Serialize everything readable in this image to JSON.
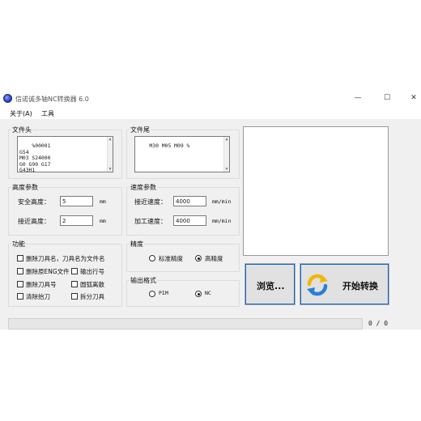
{
  "window": {
    "title": "信诺诚多轴NC转换器 6.0",
    "minimize": "—",
    "maximize": "☐",
    "close": "✕"
  },
  "menu": [
    "关于(A)",
    "工具"
  ],
  "file_header": {
    "title": "文件头",
    "lines": "%00001\nG54\nM03 S24000\nG0 G90 G17\nG43H1"
  },
  "file_tail": {
    "title": "文件尾",
    "lines": "M30 M05 M09 %"
  },
  "height_params": {
    "title": "高度参数",
    "safe_label": "安全高度：",
    "safe_value": "5",
    "safe_unit": "mm",
    "approach_label": "接近高度：",
    "approach_value": "2",
    "approach_unit": "mm"
  },
  "speed_params": {
    "title": "速度参数",
    "approach_label": "接近速度：",
    "approach_value": "4000",
    "approach_unit": "mm/min",
    "feed_label": "加工速度：",
    "feed_value": "4000",
    "feed_unit": "mm/min"
  },
  "functions": {
    "title": "功能",
    "options": [
      {
        "label": "删除刀具名，刀具名为文件名",
        "checked": false
      },
      {
        "label": "删除原ENG文件",
        "checked": false
      },
      {
        "label": "输出行号",
        "checked": false
      },
      {
        "label": "删除刀具号",
        "checked": false
      },
      {
        "label": "圆弧离散",
        "checked": false
      },
      {
        "label": "清除抬刀",
        "checked": false
      },
      {
        "label": "拆分刀具",
        "checked": false
      }
    ]
  },
  "precision": {
    "title": "精度",
    "standard": "标准精度",
    "high": "高精度",
    "selected": "high"
  },
  "output_format": {
    "title": "输出格式",
    "pim": "PIM",
    "nc": "NC",
    "selected": "nc"
  },
  "buttons": {
    "browse": "浏览...",
    "convert": "开始转换"
  },
  "status": {
    "count": "0 / 0"
  },
  "colors": {
    "accent": "#0a64c9",
    "arrow_yellow": "#f2b705",
    "arrow_blue": "#2b7fd6"
  }
}
